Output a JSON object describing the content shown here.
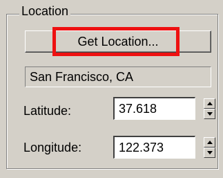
{
  "group": {
    "title": "Location"
  },
  "button": {
    "get_location_label": "Get Location..."
  },
  "location": {
    "display_value": "San Francisco, CA"
  },
  "latitude": {
    "label": "Latitude:",
    "value": "37.618"
  },
  "longitude": {
    "label": "Longitude:",
    "value": "122.373"
  },
  "colors": {
    "background": "#d4d0c8",
    "highlight_border": "#ee1111",
    "input_background": "#ffffff"
  },
  "icons": {
    "spinner_up": "triangle-up-icon",
    "spinner_down": "triangle-down-icon"
  }
}
